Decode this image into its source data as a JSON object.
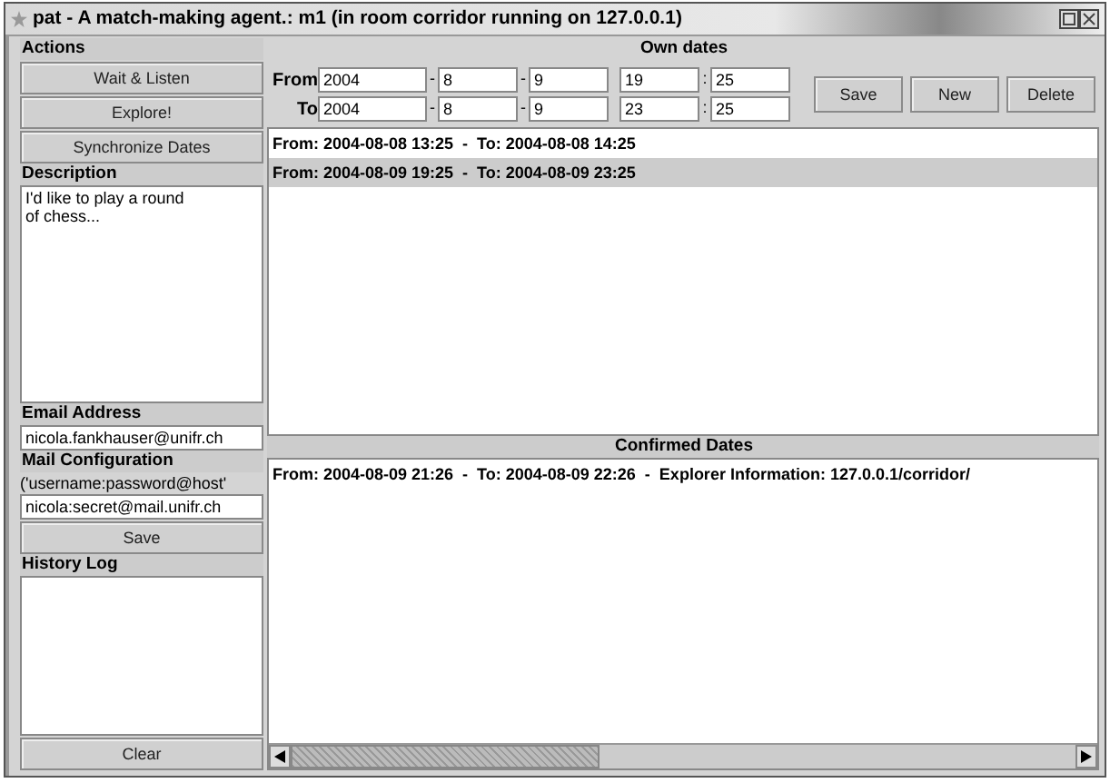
{
  "window": {
    "title": "pat - A match-making agent.: m1 (in room corridor running on 127.0.0.1)"
  },
  "actions": {
    "heading": "Actions",
    "buttons": [
      "Wait & Listen",
      "Explore!",
      "Synchronize Dates"
    ]
  },
  "description": {
    "heading": "Description",
    "value": "I'd like to play a round\nof chess..."
  },
  "email": {
    "heading": "Email Address",
    "value": "nicola.fankhauser@unifr.ch"
  },
  "mail_config": {
    "heading": "Mail Configuration",
    "hint": "('username:password@host'",
    "value": "nicola:secret@mail.unifr.ch",
    "button": "Save"
  },
  "history_log": {
    "heading": "History Log",
    "button": "Clear"
  },
  "own_dates": {
    "heading": "Own dates",
    "rows": [
      {
        "label": "From",
        "fields": [
          {
            "value": "2004"
          },
          {
            "separator": "-",
            "value": "8"
          },
          {
            "separator": "-",
            "value": "9"
          },
          {
            "value": "19"
          },
          {
            "separator": ":",
            "value": "25"
          }
        ]
      },
      {
        "label": "To",
        "fields": [
          {
            "value": "2004"
          },
          {
            "separator": "-",
            "value": "8"
          },
          {
            "separator": "-",
            "value": "9"
          },
          {
            "value": "23"
          },
          {
            "separator": ":",
            "value": "25"
          }
        ]
      }
    ],
    "buttons": [
      "Save",
      "New",
      "Delete"
    ],
    "items": [
      {
        "text": "From: 2004-08-08 13:25  -  To: 2004-08-08 14:25",
        "selected": false
      },
      {
        "text": "From: 2004-08-09 19:25  -  To: 2004-08-09 23:25",
        "selected": true
      }
    ]
  },
  "confirmed_dates": {
    "heading": "Confirmed Dates",
    "items": [
      {
        "text": "From: 2004-08-09 21:26  -  To: 2004-08-09 22:26  -  Explorer Information: 127.0.0.1/corridor/"
      }
    ]
  }
}
